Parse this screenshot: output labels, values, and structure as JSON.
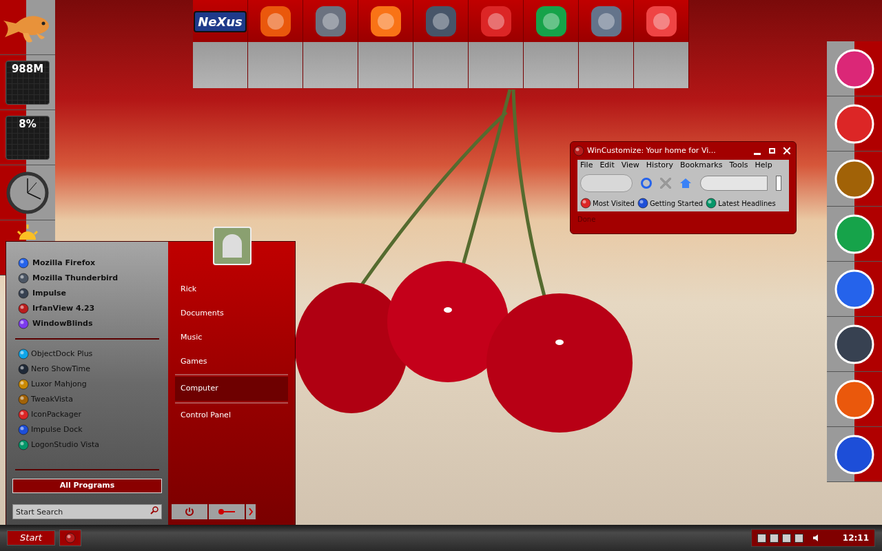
{
  "widgets": [
    {
      "kind": "fish"
    },
    {
      "kind": "meter",
      "reading": "988M"
    },
    {
      "kind": "meter",
      "reading": "8%"
    },
    {
      "kind": "clock"
    },
    {
      "kind": "weather"
    }
  ],
  "top_dock": {
    "logo_text": "NeXus"
  },
  "start_menu": {
    "pinned": [
      "Mozilla Firefox",
      "Mozilla Thunderbird",
      "Impulse",
      "IrfanView 4.23",
      "WindowBlinds"
    ],
    "recent": [
      "ObjectDock Plus",
      "Nero ShowTime",
      "Luxor Mahjong",
      "TweakVista",
      "IconPackager",
      "Impulse Dock",
      "LogonStudio Vista"
    ],
    "all_programs": "All Programs",
    "search": {
      "placeholder": "Start Search"
    },
    "places": [
      {
        "label": "Rick",
        "selected": false
      },
      {
        "label": "Documents",
        "selected": false
      },
      {
        "label": "Music",
        "selected": false
      },
      {
        "label": "Games",
        "selected": false
      },
      {
        "label": "Computer",
        "selected": true
      },
      {
        "label": "Control Panel",
        "selected": false
      }
    ]
  },
  "browser": {
    "title": "WinCustomize: Your home for Vi...",
    "menu": [
      "File",
      "Edit",
      "View",
      "History",
      "Bookmarks",
      "Tools",
      "Help"
    ],
    "bookmarks": [
      "Most Visited",
      "Getting Started",
      "Latest Headlines"
    ],
    "status": "Done"
  },
  "taskbar": {
    "start": "Start",
    "clock": "12:11"
  }
}
